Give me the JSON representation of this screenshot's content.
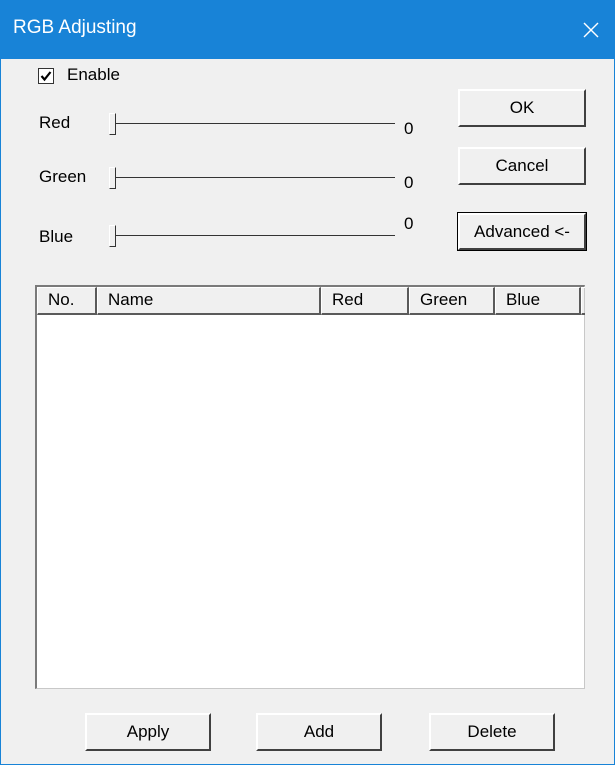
{
  "window": {
    "title": "RGB Adjusting",
    "close_icon": "close-icon"
  },
  "enable": {
    "label": "Enable",
    "checked": true
  },
  "sliders": [
    {
      "label": "Red",
      "value": "0",
      "level": 0
    },
    {
      "label": "Green",
      "value": "0",
      "level": 0
    },
    {
      "label": "Blue",
      "value": "0",
      "level": 0
    }
  ],
  "buttons": {
    "ok": "OK",
    "cancel": "Cancel",
    "advanced": "Advanced <-",
    "apply": "Apply",
    "add": "Add",
    "delete": "Delete"
  },
  "table": {
    "columns": [
      "No.",
      "Name",
      "Red",
      "Green",
      "Blue"
    ],
    "rows": []
  },
  "colors": {
    "titlebar": "#1883d7",
    "title_text": "#ffffff",
    "dialog_bg": "#f0f0f0"
  }
}
